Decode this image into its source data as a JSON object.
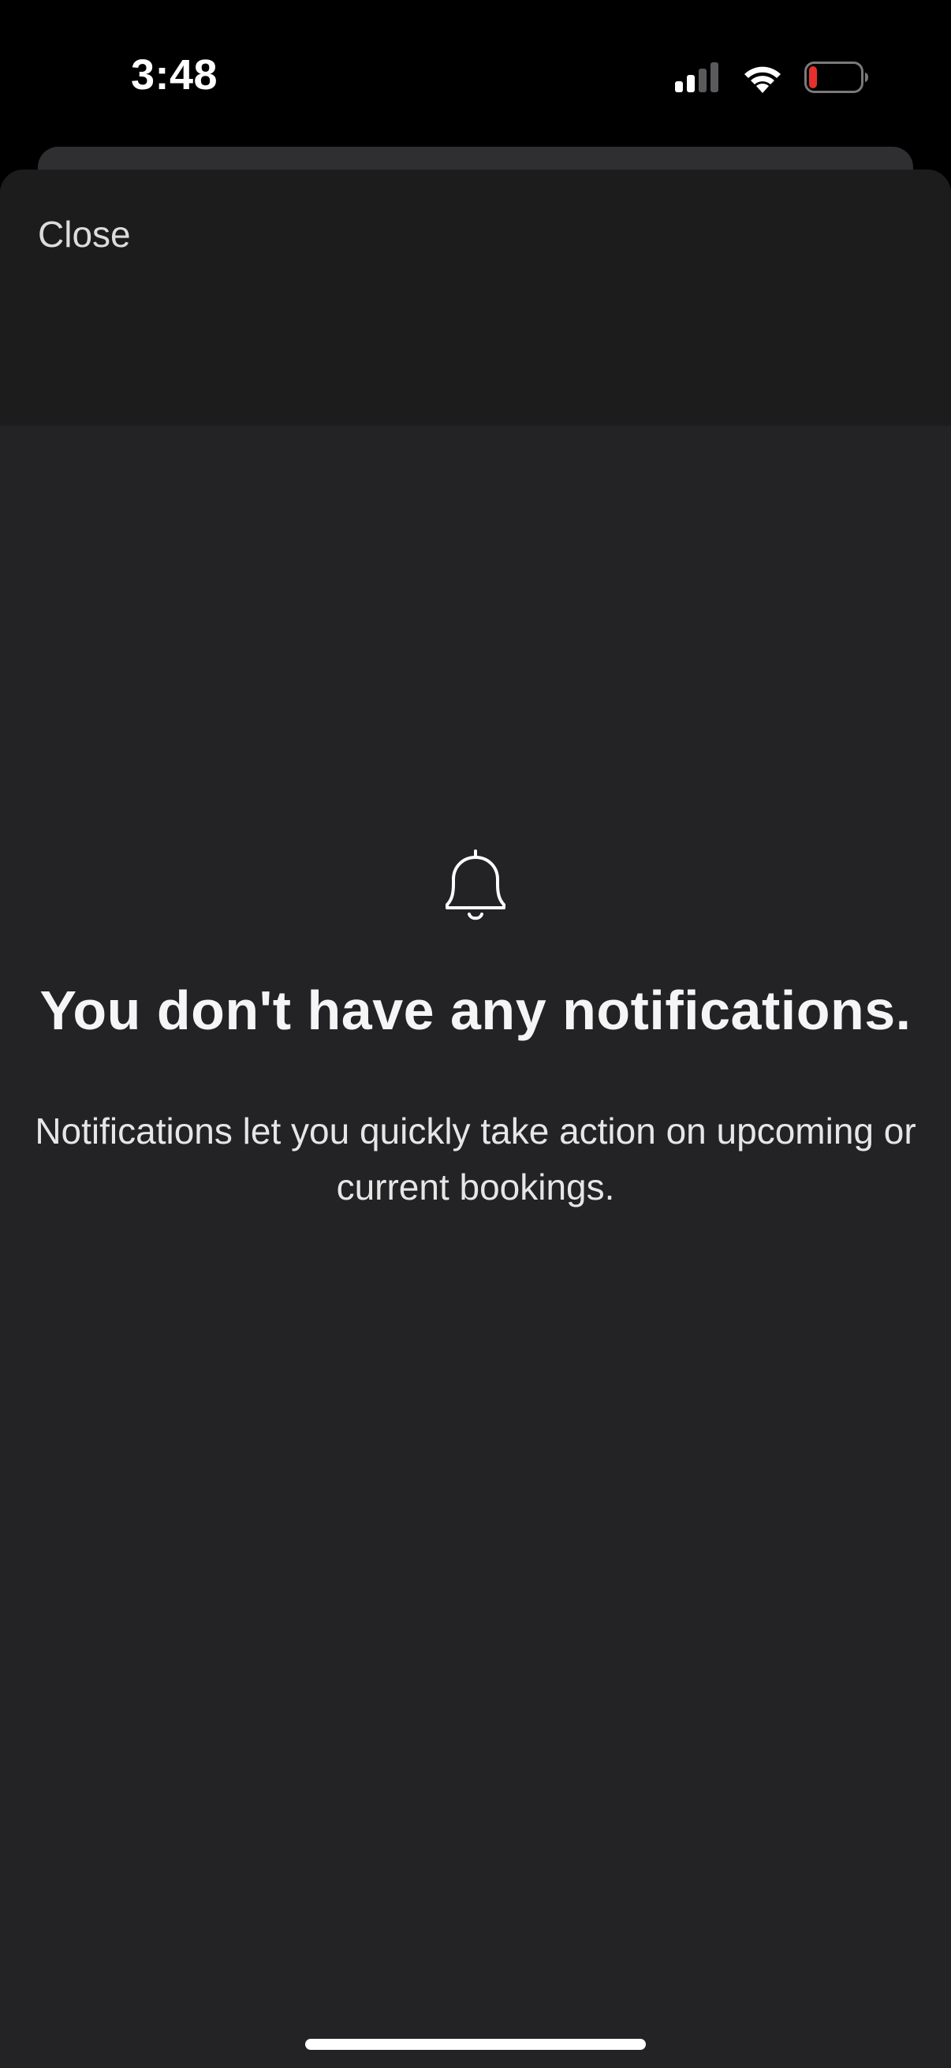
{
  "status_bar": {
    "time": "3:48",
    "battery_color": "#e5302c"
  },
  "sheet": {
    "close_label": "Close"
  },
  "empty_state": {
    "icon": "bell-icon",
    "title": "You don't have any notifications.",
    "description": "Notifications let you quickly take action on upcoming or current bookings."
  },
  "colors": {
    "background": "#000000",
    "sheet": "#232325",
    "sheet_header": "#1c1c1d",
    "text": "#ffffff"
  }
}
